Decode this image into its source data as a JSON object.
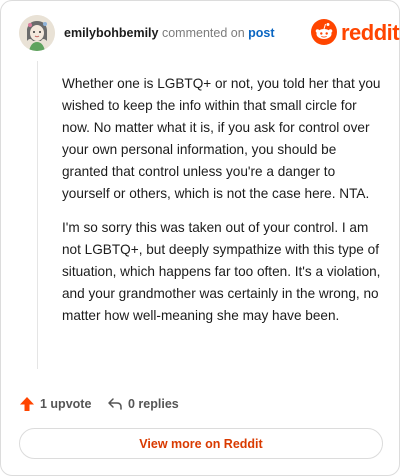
{
  "header": {
    "username": "emilybohbemily",
    "action_text": "commented on",
    "post_link": "post"
  },
  "brand": {
    "wordmark": "reddit",
    "color": "#ff4500"
  },
  "comment": {
    "paragraphs": [
      "Whether one is LGBTQ+ or not, you told her that you wished to keep the info within that small circle for now. No matter what it is, if you ask for control over your own personal information, you should be granted that control unless you're a danger to yourself or others, which is not the case here. NTA.",
      "I'm so sorry this was taken out of your control. I am not LGBTQ+, but deeply sympathize with this type of situation, which happens far too often. It's a violation, and your grandmother was certainly in the wrong, no matter how well-meaning she may have been."
    ]
  },
  "actions": {
    "upvote_label": "1 upvote",
    "replies_label": "0 replies",
    "upvote_icon": "upvote-arrow-icon",
    "reply_icon": "reply-arrow-icon"
  },
  "footer": {
    "view_more_label": "View more on Reddit"
  }
}
